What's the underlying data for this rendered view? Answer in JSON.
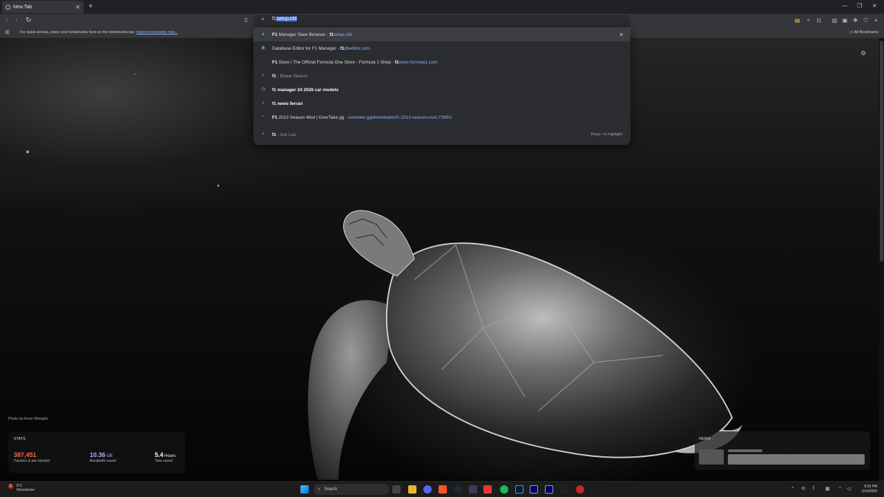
{
  "browser": {
    "tab": {
      "title": "New Tab"
    },
    "omnibox": {
      "typed": "f1",
      "autocomplete": "setup.cfd"
    },
    "bookmarks_bar": {
      "message": "For quick access, place your bookmarks here on the bookmarks bar.",
      "import_link": "Import bookmarks now...",
      "all_bookmarks": "All Bookmarks"
    }
  },
  "suggestions": [
    {
      "pre": "F1",
      "title": " Manager Save Browser",
      "sep": " - ",
      "url_bold": "f1",
      "url_rest": "setup.cfd",
      "icon": "site-icon",
      "glyph": "▲",
      "color": "#5aa05a"
    },
    {
      "pre": "",
      "title": "Database Editor for F1 Manager",
      "sep": " - ",
      "url_bold": "f1",
      "url_rest": "dbeditor.com",
      "icon": "site-icon",
      "glyph": "◉",
      "color": "#9b7fd6"
    },
    {
      "pre": "F1",
      "title": " Store | The Official Formula One Store - Formula 1 Shop",
      "sep": " - ",
      "url_bold": "f1",
      "url_rest": "store.formula1.com",
      "icon": "f1-icon",
      "glyph": "—",
      "color": "#e10600"
    },
    {
      "pre": "f1",
      "title": "",
      "sep": " - ",
      "dim": "Brave Search",
      "icon": "search-icon",
      "glyph": "⌕",
      "color": "#aaa"
    },
    {
      "pre": "f1",
      "title": " manager 24 2026 car models",
      "bold_title": true,
      "icon": "history-icon",
      "glyph": "◷",
      "color": "#aaa"
    },
    {
      "pre": "f1",
      "title": " news ferrari",
      "bold_title": true,
      "icon": "search-icon",
      "glyph": "⌕",
      "color": "#aaa"
    },
    {
      "pre": "F1",
      "title": " 2013 Season Mod | OverTake.gg",
      "sep": " - ",
      "url_bold": "",
      "url_rest": "overtake.gg/downloads/f1-2013-season-mod.73981/",
      "icon": "overtake-icon",
      "glyph": "~",
      "color": "#ccc"
    },
    {
      "pre": "f1",
      "title": "",
      "sep": " - ",
      "dim": "Ask Leo",
      "icon": "leo-icon",
      "glyph": "✦",
      "color": "#c13e8c",
      "hint": "Press ! to highlight"
    }
  ],
  "page": {
    "photo_credit": "Photo by Anne Wangler",
    "stats": {
      "header": "STATS",
      "items": [
        {
          "value": "387,451",
          "unit": "",
          "label": "Trackers & ads blocked",
          "color": "#ff6a47"
        },
        {
          "value": "10.36",
          "unit": " GB",
          "label": "Bandwidth saved",
          "color": "#a9b4ff"
        },
        {
          "value": "5.4",
          "unit": " Hours",
          "label": "Time saved",
          "color": "#ffffff"
        }
      ]
    },
    "news": {
      "header": "NEWS"
    }
  },
  "taskbar": {
    "weather": {
      "badge": "1",
      "temp": "8°C",
      "desc": "Nieuwbouw"
    },
    "search_placeholder": "Search",
    "clock": {
      "time": "8:36 PM",
      "date": "2/14/2026"
    }
  }
}
